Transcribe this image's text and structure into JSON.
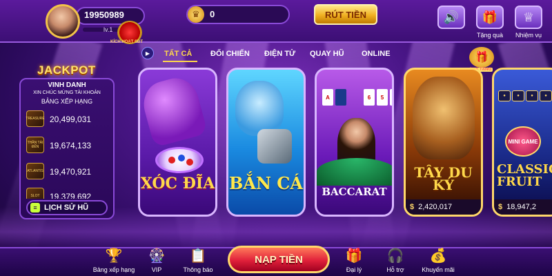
{
  "user": {
    "id": "19950989",
    "level": "lv.1",
    "badge_text": "KÍCH HOẠT SĐT"
  },
  "balance": {
    "value": "0",
    "icon": "crown-coin-icon"
  },
  "header": {
    "withdraw_label": "RÚT TIỀN",
    "sound_label": "",
    "gift_label": "Tặng quà",
    "mission_label": "Nhiệm vụ"
  },
  "tabs": [
    {
      "label": "TẤT CẢ",
      "active": true
    },
    {
      "label": "ĐỐI CHIẾN",
      "active": false
    },
    {
      "label": "ĐIỆN TỬ",
      "active": false
    },
    {
      "label": "QUAY HŨ",
      "active": false
    },
    {
      "label": "ONLINE",
      "active": false
    }
  ],
  "promo": {
    "gift_badge": "QUÀ TẶNG"
  },
  "jackpot": {
    "title": "JACKPOT",
    "heading": "VINH DANH",
    "subheading": "XIN CHÚC MỪNG TÀI KHOẢN",
    "rank_label": "BẢNG XẾP HẠNG",
    "entries": [
      {
        "game": "TREASURE",
        "value": "20,499,031"
      },
      {
        "game": "THẦN TÀI ĐẾN",
        "value": "19,674,133"
      },
      {
        "game": "ATLANTIS",
        "value": "19,470,921"
      },
      {
        "game": "SLOT",
        "value": "19,379,692"
      }
    ],
    "history_label": "LỊCH SỬ HŨ"
  },
  "games": [
    {
      "title": "XÓC ĐĨA",
      "jackpot": ""
    },
    {
      "title": "BẮN CÁ",
      "jackpot": ""
    },
    {
      "title": "BACCARAT",
      "jackpot": ""
    },
    {
      "title": "TÂY DU KÝ",
      "jackpot": "2,420,017"
    },
    {
      "title": "CLASSIC FRUIT",
      "jackpot": "18,947,2",
      "mini_label": "MINI GAME"
    }
  ],
  "bottom_nav": {
    "ranking_label": "Bảng xếp hạng",
    "vip_label": "VIP",
    "notice_label": "Thông báo",
    "deposit_label": "NẠP TIỀN",
    "agent_label": "Đại lý",
    "support_label": "Hỗ trợ",
    "promo_label": "Khuyến mãi"
  },
  "colors": {
    "accent_gold": "#ffd84a",
    "primary_purple": "#5b1a9c",
    "deposit_red": "#e0203a"
  }
}
